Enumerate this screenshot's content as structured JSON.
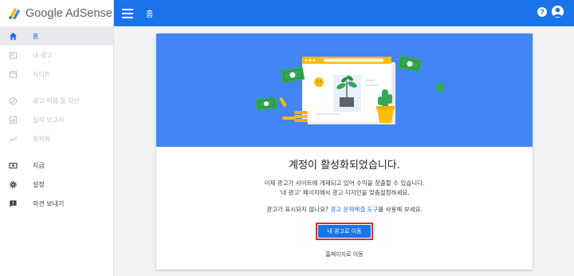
{
  "app": {
    "title": "Google AdSense"
  },
  "topbar": {
    "title": "홈",
    "help_label": "?"
  },
  "sidebar": {
    "items": [
      {
        "label": "홈",
        "icon": "home-icon",
        "state": "active"
      },
      {
        "label": "내 광고",
        "icon": "ad-unit-icon",
        "state": "disabled"
      },
      {
        "label": "사이트",
        "icon": "site-icon",
        "state": "disabled"
      },
      {
        "label": "광고 허용 및 차단",
        "icon": "block-icon",
        "state": "disabled"
      },
      {
        "label": "실적 보고서",
        "icon": "bar-chart-icon",
        "state": "disabled"
      },
      {
        "label": "최적화",
        "icon": "trending-up-icon",
        "state": "disabled"
      },
      {
        "label": "지급",
        "icon": "payments-icon",
        "state": "enabled"
      },
      {
        "label": "설정",
        "icon": "gear-icon",
        "state": "enabled"
      },
      {
        "label": "의견 보내기",
        "icon": "feedback-icon",
        "state": "enabled"
      }
    ]
  },
  "card": {
    "heading": "계정이 활성화되었습니다.",
    "body_line1": "이제 광고가 사이트에 게재되고 있어 수익을 창출할 수 있습니다.",
    "body_line2": "'내 광고' 페이지에서 광고 디자인을 맞춤설정하세요.",
    "troubleshoot_prefix": "광고가 표시되지 않나요?",
    "troubleshoot_link": "광고 문제해결 도구",
    "troubleshoot_suffix": "를 사용해 보세요.",
    "primary_button": "내 광고로 이동",
    "secondary_link": "홈페이지로 이동"
  },
  "colors": {
    "primary": "#1a73e8",
    "hero": "#4285f4",
    "highlight": "#d93025"
  }
}
